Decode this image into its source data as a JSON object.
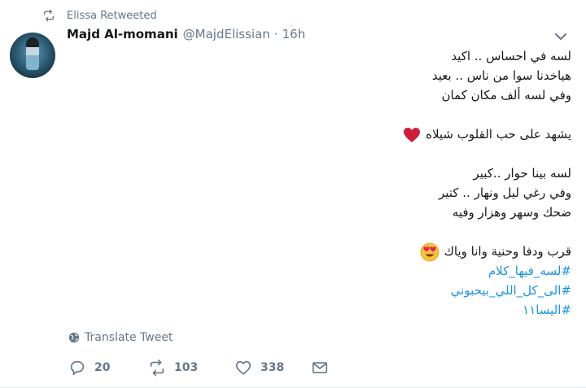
{
  "retweet_context": {
    "text": "Elissa Retweeted",
    "icon": "retweet-icon"
  },
  "author": {
    "name": "Majd Al-momani",
    "handle": "@MajdElissian",
    "separator": "·",
    "time": "16h"
  },
  "body": {
    "stanza1": [
      "لسه في احساس .. اكيد",
      "هياخدنا سوا من ناس .. بعيد",
      "وفي لسه ألف مكان كمان"
    ],
    "stanza2": [
      "يشهد على حب القلوب شيلاه"
    ],
    "stanza3": [
      "لسه بينا حوار ..كبير",
      "وفي رغي ليل ونهار .. كتير",
      "ضحك وسهر وهزار وفيه"
    ],
    "stanza4": [
      "قرب ودفا وحنية وانا وياك"
    ],
    "hashtags": [
      "#لسه_فيها_كلام",
      "#الى_كل_اللي_بيحبوني",
      "#اليسا١١"
    ]
  },
  "emojis": {
    "heart": "red-heart",
    "face": "heart-eyes-face"
  },
  "translate_label": "Translate Tweet",
  "actions": {
    "replies": "20",
    "retweets": "103",
    "likes": "338"
  },
  "colors": {
    "link": "#1b95e0",
    "muted": "#657786",
    "text": "#14171a",
    "heart": "#e0245e"
  }
}
